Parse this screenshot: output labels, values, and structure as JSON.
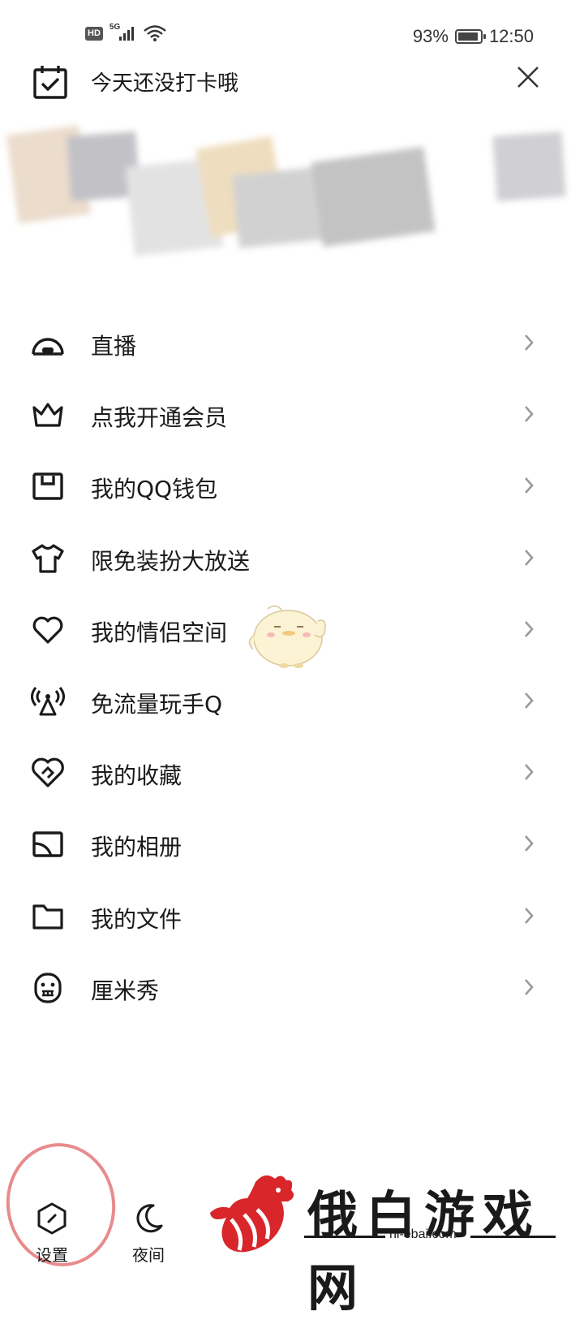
{
  "status_bar": {
    "hd_badge": "HD",
    "network": "5G",
    "battery_percent": "93%",
    "battery_level": 0.93,
    "time": "12:50"
  },
  "checkin": {
    "title": "今天还没打卡哦",
    "icon": "calendar-check-icon",
    "close_icon": "close-icon"
  },
  "menu": {
    "items": [
      {
        "label": "直播",
        "icon": "live-icon"
      },
      {
        "label": "点我开通会员",
        "icon": "crown-icon"
      },
      {
        "label": "我的QQ钱包",
        "icon": "wallet-icon"
      },
      {
        "label": "限免装扮大放送",
        "icon": "tshirt-icon"
      },
      {
        "label": "我的情侣空间",
        "icon": "heart-icon"
      },
      {
        "label": "免流量玩手Q",
        "icon": "signal-tower-icon"
      },
      {
        "label": "我的收藏",
        "icon": "favorite-icon"
      },
      {
        "label": "我的相册",
        "icon": "album-icon"
      },
      {
        "label": "我的文件",
        "icon": "folder-icon"
      },
      {
        "label": "厘米秀",
        "icon": "cmshow-face-icon"
      }
    ]
  },
  "bottom_bar": {
    "settings_label": "设置",
    "night_label": "夜间"
  },
  "watermark": {
    "title": "俄白游戏网",
    "domain": "hi-ebai.com"
  },
  "colors": {
    "text": "#1a1a1a",
    "chevron": "#9a9a9a",
    "highlight_circle": "#e88b8c",
    "watermark_red": "#d8262a"
  }
}
